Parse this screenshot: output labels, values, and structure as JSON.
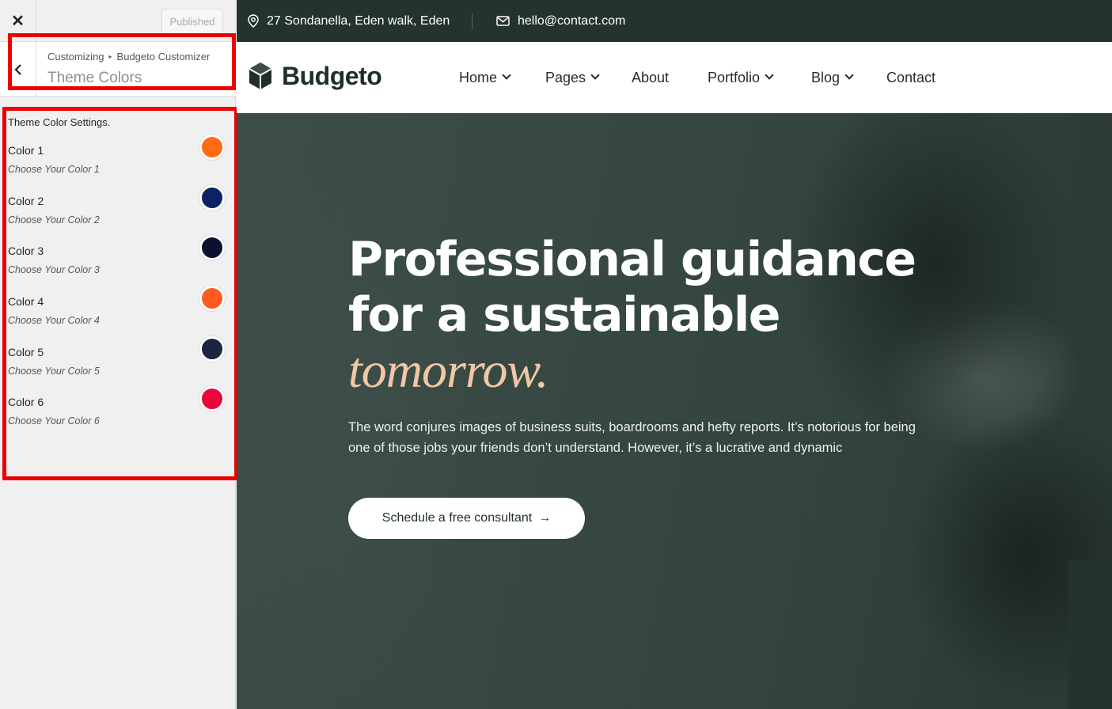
{
  "customizer": {
    "close_glyph": "✕",
    "published_label": "Published",
    "back_glyph": "‹",
    "breadcrumb": {
      "root": "Customizing",
      "separator": "▸",
      "parent": "Budgeto Customizer"
    },
    "section_title": "Theme Colors",
    "settings_title": "Theme Color Settings.",
    "colors": [
      {
        "label": "Color 1",
        "description": "Choose Your Color 1",
        "value": "#ff6a13"
      },
      {
        "label": "Color 2",
        "description": "Choose Your Color 2",
        "value": "#0a2463"
      },
      {
        "label": "Color 3",
        "description": "Choose Your Color 3",
        "value": "#0b1230"
      },
      {
        "label": "Color 4",
        "description": "Choose Your Color 4",
        "value": "#ff5a1f"
      },
      {
        "label": "Color 5",
        "description": "Choose Your Color 5",
        "value": "#1c2440"
      },
      {
        "label": "Color 6",
        "description": "Choose Your Color 6",
        "value": "#e8063c"
      }
    ],
    "highlight_color": "#ee0000"
  },
  "site": {
    "topbar": {
      "address": "27 Sondanella, Eden walk, Eden",
      "email": "hello@contact.com"
    },
    "brand": {
      "name": "Budgeto"
    },
    "nav": [
      {
        "label": "Home",
        "dropdown": true
      },
      {
        "label": "Pages",
        "dropdown": true
      },
      {
        "label": "About",
        "dropdown": false
      },
      {
        "label": "Portfolio",
        "dropdown": true
      },
      {
        "label": "Blog",
        "dropdown": true
      },
      {
        "label": "Contact",
        "dropdown": false
      }
    ],
    "hero": {
      "title_line_1": "Professional guidance",
      "title_line_2": "for a sustainable",
      "title_accent": "tomorrow.",
      "paragraph": "The word conjures images of business suits, boardrooms and hefty reports. It’s notorious for being one of those jobs your friends don’t understand. However, it’s a lucrative and dynamic",
      "cta_label": "Schedule a free consultant",
      "cta_arrow": "→"
    },
    "colors": {
      "topbar_bg": "#243230",
      "accent": "#f2c7a6"
    }
  }
}
